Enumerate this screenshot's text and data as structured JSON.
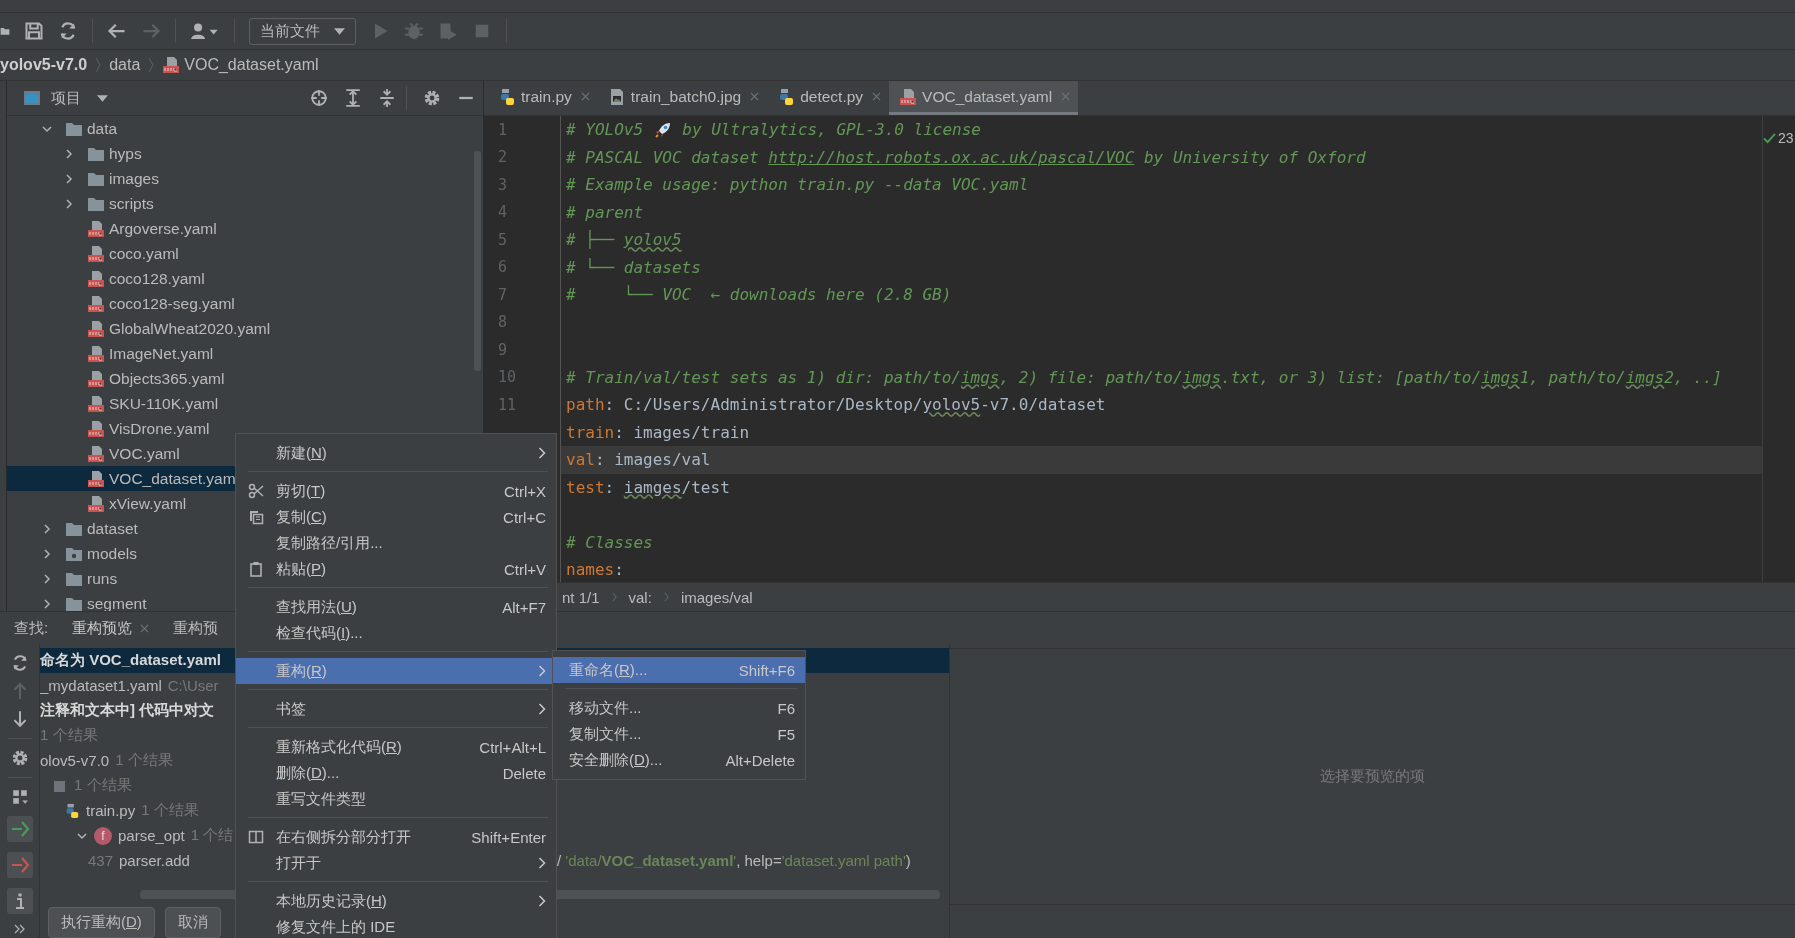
{
  "toolbar": {
    "run_config": "当前文件"
  },
  "breadcrumb": [
    {
      "label": "yolov5-v7.0",
      "kind": "project"
    },
    {
      "label": "data",
      "kind": "folder"
    },
    {
      "label": "VOC_dataset.yaml",
      "kind": "yaml"
    }
  ],
  "project_panel": {
    "title": "项目",
    "tree": [
      {
        "label": "data",
        "kind": "folder",
        "expanded": true,
        "selected": false,
        "children": [
          {
            "label": "hyps",
            "kind": "folder",
            "expanded": false,
            "selected": false
          },
          {
            "label": "images",
            "kind": "folder",
            "expanded": false,
            "selected": false
          },
          {
            "label": "scripts",
            "kind": "folder",
            "expanded": false,
            "selected": false
          },
          {
            "label": "Argoverse.yaml",
            "kind": "yaml",
            "selected": false
          },
          {
            "label": "coco.yaml",
            "kind": "yaml",
            "selected": false
          },
          {
            "label": "coco128.yaml",
            "kind": "yaml",
            "selected": false
          },
          {
            "label": "coco128-seg.yaml",
            "kind": "yaml",
            "selected": false
          },
          {
            "label": "GlobalWheat2020.yaml",
            "kind": "yaml",
            "selected": false
          },
          {
            "label": "ImageNet.yaml",
            "kind": "yaml",
            "selected": false
          },
          {
            "label": "Objects365.yaml",
            "kind": "yaml",
            "selected": false
          },
          {
            "label": "SKU-110K.yaml",
            "kind": "yaml",
            "selected": false
          },
          {
            "label": "VisDrone.yaml",
            "kind": "yaml",
            "selected": false
          },
          {
            "label": "VOC.yaml",
            "kind": "yaml",
            "selected": false
          },
          {
            "label": "VOC_dataset.yam",
            "kind": "yaml",
            "selected": true
          },
          {
            "label": "xView.yaml",
            "kind": "yaml",
            "selected": false
          }
        ]
      },
      {
        "label": "dataset",
        "kind": "folder",
        "expanded": false,
        "selected": false
      },
      {
        "label": "models",
        "kind": "source_folder",
        "expanded": false,
        "selected": false
      },
      {
        "label": "runs",
        "kind": "folder",
        "expanded": false,
        "selected": false
      },
      {
        "label": "segment",
        "kind": "folder",
        "expanded": false,
        "selected": false
      }
    ]
  },
  "tabs": [
    {
      "label": "train.py",
      "kind": "python",
      "selected": false
    },
    {
      "label": "train_batch0.jpg",
      "kind": "image",
      "selected": false
    },
    {
      "label": "detect.py",
      "kind": "python",
      "selected": false
    },
    {
      "label": "VOC_dataset.yaml",
      "kind": "yaml",
      "selected": true
    }
  ],
  "editor": {
    "inspection_count": "23",
    "lines": [
      {
        "number": "1",
        "current": false,
        "segments": [
          {
            "kind": "comment",
            "text": "# YOLOv5 "
          },
          {
            "kind": "rocket"
          },
          {
            "kind": "comment",
            "text": " by Ultralytics, GPL-3.0 license"
          }
        ]
      },
      {
        "number": "2",
        "current": false,
        "segments": [
          {
            "kind": "comment",
            "text": "# PASCAL VOC dataset "
          },
          {
            "kind": "link",
            "text": "http://host.robots.ox.ac.uk/pascal/VOC"
          },
          {
            "kind": "comment",
            "text": " by University of Oxford"
          }
        ]
      },
      {
        "number": "3",
        "current": false,
        "segments": [
          {
            "kind": "comment",
            "text": "# Example usage: python train.py --data VOC.yaml"
          }
        ]
      },
      {
        "number": "4",
        "current": false,
        "segments": [
          {
            "kind": "comment",
            "text": "# parent"
          }
        ]
      },
      {
        "number": "5",
        "current": false,
        "segments": [
          {
            "kind": "comment",
            "text": "# ├── "
          },
          {
            "kind": "comment_typo",
            "text": "yolov5"
          }
        ]
      },
      {
        "number": "6",
        "current": false,
        "segments": [
          {
            "kind": "comment",
            "text": "# └── datasets"
          }
        ]
      },
      {
        "number": "7",
        "current": false,
        "segments": [
          {
            "kind": "comment",
            "text": "#     └── VOC  ← downloads here (2.8 GB)"
          }
        ]
      },
      {
        "number": "8",
        "current": false
      },
      {
        "number": "9",
        "current": false
      },
      {
        "number": "10",
        "current": false,
        "segments": [
          {
            "kind": "comment",
            "text": "# Train/val/test sets as 1) dir: path/to/"
          },
          {
            "kind": "comment_typo",
            "text": "imgs"
          },
          {
            "kind": "comment",
            "text": ", 2) file: path/to/"
          },
          {
            "kind": "comment_typo",
            "text": "imgs"
          },
          {
            "kind": "comment",
            "text": ".txt, or 3) list: [path/to/"
          },
          {
            "kind": "comment_typo",
            "text": "imgs"
          },
          {
            "kind": "comment",
            "text": "1, path/to/"
          },
          {
            "kind": "comment_typo",
            "text": "imgs"
          },
          {
            "kind": "comment",
            "text": "2, ..]"
          }
        ]
      },
      {
        "number": "11",
        "current": false,
        "segments": [
          {
            "kind": "key",
            "text": "path"
          },
          {
            "kind": "plain",
            "text": ": C:/Users/Administrator/Desktop/"
          },
          {
            "kind": "typo",
            "text": "yolov5"
          },
          {
            "kind": "plain",
            "text": "-v7.0/dataset"
          }
        ]
      },
      {
        "current": false,
        "segments": [
          {
            "kind": "key",
            "text": "train"
          },
          {
            "kind": "plain",
            "text": ": images/train"
          }
        ]
      },
      {
        "current": true,
        "segments": [
          {
            "kind": "key",
            "text": "val"
          },
          {
            "kind": "plain",
            "text": ": images/val"
          }
        ]
      },
      {
        "current": false,
        "segments": [
          {
            "kind": "key",
            "text": "test"
          },
          {
            "kind": "plain",
            "text": ": "
          },
          {
            "kind": "typo",
            "text": "iamges"
          },
          {
            "kind": "plain",
            "text": "/test"
          }
        ]
      },
      {
        "current": false
      },
      {
        "current": false,
        "segments": [
          {
            "kind": "comment",
            "text": "# Classes"
          }
        ]
      },
      {
        "current": false,
        "segments": [
          {
            "kind": "key",
            "text": "names"
          },
          {
            "kind": "plain",
            "text": ":"
          }
        ]
      }
    ],
    "breadcrumb": [
      "nt 1/1",
      "val:",
      "images/val"
    ]
  },
  "context_menu": [
    {
      "kind": "item",
      "label": [
        "新建(",
        "N",
        ")"
      ],
      "submenu": true,
      "selected": false
    },
    {
      "kind": "separator"
    },
    {
      "kind": "cut",
      "label": [
        "剪切(",
        "T",
        ")"
      ],
      "shortcut": "Ctrl+X",
      "selected": false
    },
    {
      "kind": "copy",
      "label": [
        "复制(",
        "C",
        ")"
      ],
      "shortcut": "Ctrl+C",
      "selected": false
    },
    {
      "kind": "item",
      "label": "复制路径/引用...",
      "selected": false
    },
    {
      "kind": "paste",
      "label": [
        "粘贴(",
        "P",
        ")"
      ],
      "shortcut": "Ctrl+V",
      "selected": false
    },
    {
      "kind": "separator"
    },
    {
      "kind": "item",
      "label": [
        "查找用法(",
        "U",
        ")"
      ],
      "shortcut": "Alt+F7",
      "selected": false
    },
    {
      "kind": "item",
      "label": [
        "检查代码(",
        "I",
        ")..."
      ],
      "selected": false
    },
    {
      "kind": "separator"
    },
    {
      "kind": "item",
      "label": [
        "重构(",
        "R",
        ")"
      ],
      "submenu": true,
      "selected": true
    },
    {
      "kind": "separator"
    },
    {
      "kind": "item",
      "label": "书签",
      "submenu": true,
      "selected": false
    },
    {
      "kind": "separator"
    },
    {
      "kind": "item",
      "label": [
        "重新格式化代码(",
        "R",
        ")"
      ],
      "shortcut": "Ctrl+Alt+L",
      "selected": false
    },
    {
      "kind": "item",
      "label": [
        "删除(",
        "D",
        ")..."
      ],
      "shortcut": "Delete",
      "selected": false
    },
    {
      "kind": "item",
      "label": "重写文件类型",
      "selected": false
    },
    {
      "kind": "separator"
    },
    {
      "kind": "split",
      "label": "在右侧拆分部分打开",
      "shortcut": "Shift+Enter",
      "selected": false
    },
    {
      "kind": "item",
      "label": "打开于",
      "submenu": true,
      "selected": false
    },
    {
      "kind": "separator"
    },
    {
      "kind": "item",
      "label": [
        "本地历史记录(",
        "H",
        ")"
      ],
      "submenu": true,
      "selected": false
    },
    {
      "kind": "item",
      "label": "修复文件上的 IDE",
      "selected": false
    }
  ],
  "submenu": [
    {
      "kind": "item",
      "label": [
        "重命名(",
        "R",
        ")..."
      ],
      "shortcut": "Shift+F6",
      "selected": true
    },
    {
      "kind": "separator"
    },
    {
      "kind": "item",
      "label": "移动文件...",
      "shortcut": "F6",
      "selected": false
    },
    {
      "kind": "item",
      "label": "复制文件...",
      "shortcut": "F5",
      "selected": false
    },
    {
      "kind": "item",
      "label": [
        "安全删除(",
        "D",
        ")..."
      ],
      "shortcut": "Alt+Delete",
      "selected": false
    }
  ],
  "find_panel": {
    "label": "查找:",
    "tabs": [
      {
        "label": "重构预览",
        "closable": true,
        "selected": true
      },
      {
        "label": "重构预",
        "closable": false,
        "selected": false
      }
    ],
    "rows": [
      {
        "parts": [
          {
            "kind": "bold",
            "text": "命名为 VOC_dataset.yaml"
          }
        ],
        "selected": true
      },
      {
        "parts": [
          {
            "kind": "plain",
            "text": "_mydataset1.yaml"
          },
          {
            "kind": "dim",
            "text": "C:\\User"
          }
        ],
        "selected": false
      },
      {
        "parts": [
          {
            "kind": "bold",
            "text": "注释和文本中] 代码中对文"
          }
        ],
        "selected": false
      },
      {
        "parts": [
          {
            "kind": "dim",
            "text": "1 个结果"
          }
        ],
        "selected": false
      },
      {
        "parts": [
          {
            "kind": "plain",
            "text": "olov5-v7.0"
          },
          {
            "kind": "dim",
            "text": "1 个结果"
          }
        ],
        "selected": false,
        "children": [
          {
            "kind": "module",
            "parts": [
              {
                "kind": "dim",
                "text": "1 个结果"
              }
            ],
            "selected": false,
            "children": [
              {
                "kind": "python",
                "parts": [
                  {
                    "kind": "plain",
                    "text": "train.py"
                  },
                  {
                    "kind": "dim",
                    "text": "1 个结果"
                  }
                ],
                "selected": false,
                "children": [
                  {
                    "kind": "function",
                    "badge": "f",
                    "expanded": true,
                    "parts": [
                      {
                        "kind": "plain",
                        "text": "parse_opt"
                      },
                      {
                        "kind": "dim",
                        "text": "1 个结"
                      }
                    ],
                    "selected": false,
                    "children": [
                      {
                        "parts": [
                          {
                            "kind": "dim",
                            "text": "437"
                          },
                          {
                            "kind": "plain",
                            "text": "parser.add"
                          }
                        ],
                        "selected": false,
                        "continuation": [
                          {
                            "kind": "plain",
                            "text": "/ "
                          },
                          {
                            "kind": "string",
                            "text": "'data/"
                          },
                          {
                            "kind": "string_bold",
                            "text": "VOC_dataset.yaml"
                          },
                          {
                            "kind": "string",
                            "text": "'"
                          },
                          {
                            "kind": "plain",
                            "text": ", help="
                          },
                          {
                            "kind": "string",
                            "text": "'dataset.yaml path'"
                          },
                          {
                            "kind": "plain",
                            "text": ")"
                          }
                        ]
                      }
                    ]
                  }
                ]
              }
            ]
          }
        ]
      }
    ],
    "buttons": [
      {
        "label": [
          "执行重构(",
          "D",
          ")"
        ]
      },
      {
        "label": "取消"
      }
    ],
    "preview_hint": "选择要预览的项"
  }
}
